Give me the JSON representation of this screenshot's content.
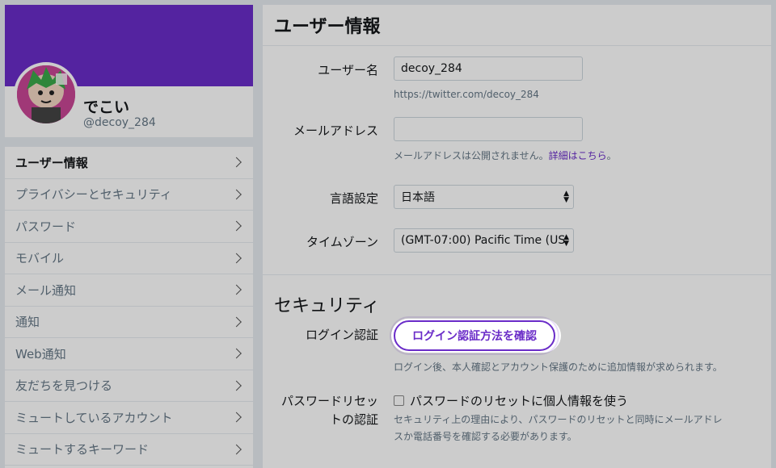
{
  "profile": {
    "display_name": "でこい",
    "handle": "@decoy_284",
    "banner_color": "#6a2cc8"
  },
  "nav": {
    "items": [
      {
        "label": "ユーザー情報",
        "active": true
      },
      {
        "label": "プライバシーとセキュリティ"
      },
      {
        "label": "パスワード"
      },
      {
        "label": "モバイル"
      },
      {
        "label": "メール通知"
      },
      {
        "label": "通知"
      },
      {
        "label": "Web通知"
      },
      {
        "label": "友だちを見つける"
      },
      {
        "label": "ミュートしているアカウント"
      },
      {
        "label": "ミュートするキーワード"
      }
    ]
  },
  "main": {
    "title": "ユーザー情報",
    "username": {
      "label": "ユーザー名",
      "value": "decoy_284",
      "url": "https://twitter.com/decoy_284"
    },
    "email": {
      "label": "メールアドレス",
      "value": "",
      "hint": "メールアドレスは公開されません。",
      "hint_link": "詳細はこちら",
      "hint_end": "。"
    },
    "language": {
      "label": "言語設定",
      "value": "日本語"
    },
    "timezone": {
      "label": "タイムゾーン",
      "value": "(GMT-07:00) Pacific Time (US"
    },
    "security": {
      "title": "セキュリティ",
      "login_verification": {
        "label": "ログイン認証",
        "button": "ログイン認証方法を確認",
        "hint": "ログイン後、本人確認とアカウント保護のために追加情報が求められます。"
      },
      "password_reset": {
        "label_line1": "パスワードリセッ",
        "label_line2": "トの認証",
        "checkbox_label": "パスワードのリセットに個人情報を使う",
        "checked": false,
        "desc_line1": "セキュリティ上の理由により、パスワードのリセットと同時にメールアドレ",
        "desc_line2": "スか電話番号を確認する必要があります。"
      }
    }
  },
  "colors": {
    "accent": "#6a2cc8",
    "avatar_bg": "#c94795"
  }
}
